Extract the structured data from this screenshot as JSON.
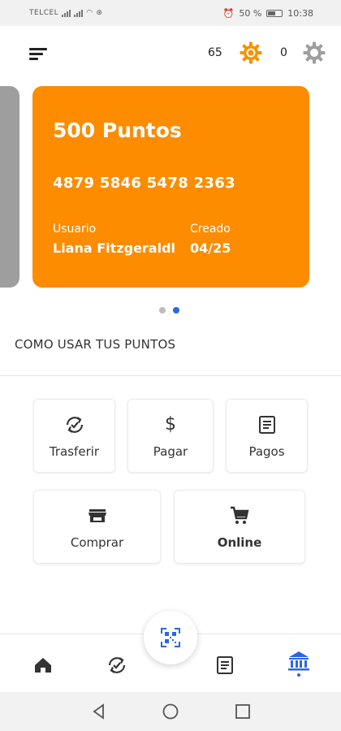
{
  "status_bar": {
    "carrier": "TELCEL",
    "battery": "50 %",
    "time": "10:38"
  },
  "header": {
    "counter_left": "65",
    "counter_right": "0",
    "accent": "#f79200"
  },
  "card": {
    "points": "500 Puntos",
    "number": "4879 5846 5478 2363",
    "user_label": "Usuario",
    "user_name": "Liana Fitzgeraldl",
    "created_label": "Creado",
    "created_date": "04/25",
    "color": "#fd8c00",
    "prev_card_color": "#9e9e9e"
  },
  "carousel": {
    "pages": 2,
    "active_index": 1,
    "active_color": "#2b66e6",
    "inactive_color": "#bdbdbd"
  },
  "section": {
    "title": "COMO USAR TUS PUNTOS"
  },
  "actions": {
    "transfer": "Trasferir",
    "pay": "Pagar",
    "payments": "Pagos",
    "buy": "Comprar",
    "online": "Online"
  },
  "bottom_nav": {
    "items": [
      "home-icon",
      "refresh-check-icon",
      "qr-scan-icon",
      "receipt-icon",
      "bank-icon"
    ],
    "active": "bank-icon",
    "active_color": "#2b66e6",
    "inactive_color": "#333333"
  }
}
